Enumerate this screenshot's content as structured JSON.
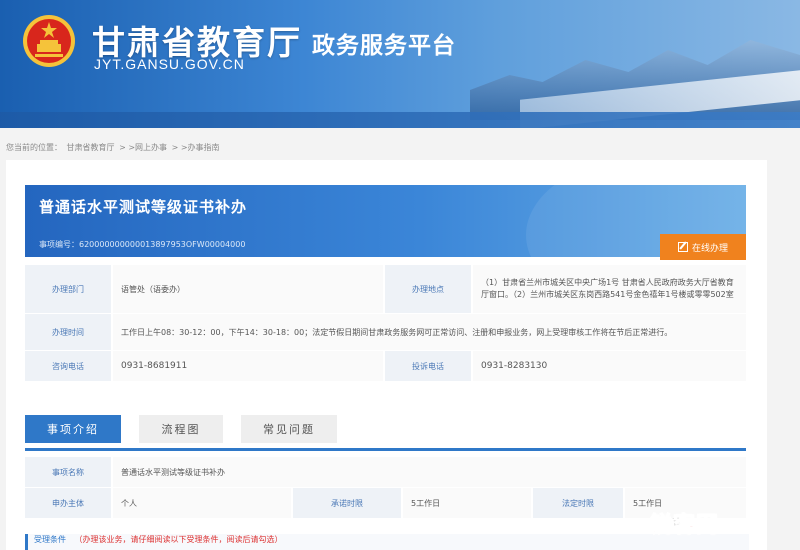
{
  "header": {
    "title": "甘肃省教育厅",
    "subtitle": "政务服务平台",
    "domain": "JYT.GANSU.GOV.CN",
    "colors": {
      "primary": "#2466bf",
      "accent": "#f0821e"
    }
  },
  "breadcrumb": [
    "您当前的位置：",
    "甘肃省教育厅",
    "> >网上办事",
    "> >办事指南"
  ],
  "service": {
    "title": "普通话水平测试等级证书补办",
    "code": "事项编号：620000000000013897953OFW00004000",
    "online_button": "在线办理"
  },
  "info": {
    "dept_label": "办理部门",
    "dept_value": "语管处（语委办）",
    "address_label": "办理地点",
    "address_value": "（1）甘肃省兰州市城关区中央广场1号 甘肃省人民政府政务大厅省教育厅窗口。（2）兰州市城关区东岗西路541号金色禧年1号楼或零零502室",
    "time_label": "办理时间",
    "time_value": "工作日上午08：30-12：00，下午14：30-18：00；法定节假日期间甘肃政务服务网可正常访问、注册和申报业务，网上受理审核工作将在节后正常进行。",
    "phone_label": "咨询电话",
    "phone_value": "0931-8681911",
    "complaint_label": "投诉电话",
    "complaint_value": "0931-8283130"
  },
  "tabs": [
    "事项介绍",
    "流程图",
    "常见问题"
  ],
  "detail": {
    "name_label": "事项名称",
    "name_value": "普通话水平测试等级证书补办",
    "subject_label": "申办主体",
    "subject_value": "个人",
    "promise_label": "承诺时限",
    "promise_value": "5工作日",
    "legal_label": "法定时限",
    "legal_value": "5工作日",
    "condition_label": "受理条件",
    "condition_note": "（办理该业务，请仔细阅读以下受理条件，阅读后请勾选）"
  },
  "watermark": {
    "brand": "锐客网",
    "faint": "育"
  }
}
